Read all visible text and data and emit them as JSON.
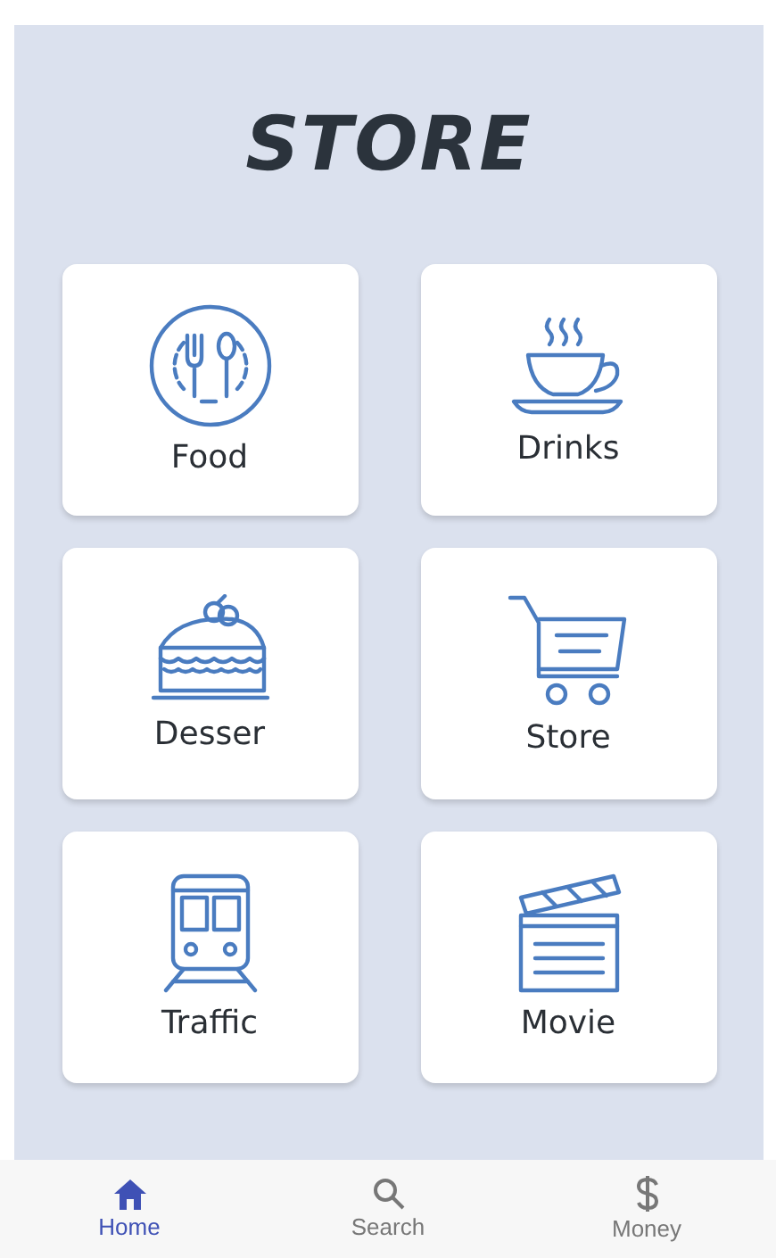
{
  "title": "STORE",
  "categories": [
    {
      "label": "Food",
      "kind": "food"
    },
    {
      "label": "Drinks",
      "kind": "drinks"
    },
    {
      "label": "Desser",
      "kind": "dessert"
    },
    {
      "label": "Store",
      "kind": "cart"
    },
    {
      "label": "Traffic",
      "kind": "train"
    },
    {
      "label": "Movie",
      "kind": "movie"
    }
  ],
  "bottom_nav": [
    {
      "label": "Home",
      "kind": "home",
      "selected": true
    },
    {
      "label": "Search",
      "kind": "search",
      "selected": false
    },
    {
      "label": "Money",
      "kind": "money",
      "selected": false
    }
  ]
}
